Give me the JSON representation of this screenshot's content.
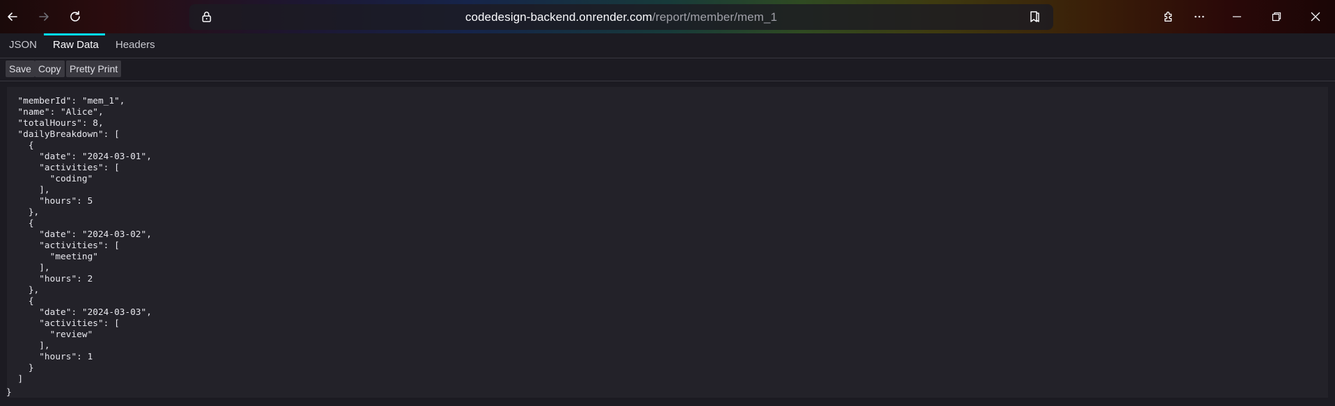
{
  "browser": {
    "url_host": "codedesign-backend.onrender.com",
    "url_path": "/report/member/mem_1"
  },
  "viewer": {
    "tabs": [
      {
        "label": "JSON",
        "active": false
      },
      {
        "label": "Raw Data",
        "active": true
      },
      {
        "label": "Headers",
        "active": false
      }
    ],
    "buttons": {
      "save": "Save",
      "copy": "Copy",
      "pretty_print": "Pretty Print"
    }
  },
  "raw_data": {
    "open_brace": "{",
    "close_brace": "}",
    "body": "  \"memberId\": \"mem_1\",\n  \"name\": \"Alice\",\n  \"totalHours\": 8,\n  \"dailyBreakdown\": [\n    {\n      \"date\": \"2024-03-01\",\n      \"activities\": [\n        \"coding\"\n      ],\n      \"hours\": 5\n    },\n    {\n      \"date\": \"2024-03-02\",\n      \"activities\": [\n        \"meeting\"\n      ],\n      \"hours\": 2\n    },\n    {\n      \"date\": \"2024-03-03\",\n      \"activities\": [\n        \"review\"\n      ],\n      \"hours\": 1\n    }\n  ]"
  },
  "icons": {
    "back": "back-arrow-icon",
    "forward": "forward-arrow-icon",
    "reload": "reload-icon",
    "lock": "lock-icon",
    "reader": "reader-view-icon",
    "extensions": "puzzle-icon",
    "menu": "more-horizontal-icon",
    "minimize": "minimize-icon",
    "restore": "restore-icon",
    "close": "close-icon"
  },
  "colors": {
    "page_background": "#1c1b22",
    "panel_background": "#232229",
    "active_tab_indicator": "#00ddff",
    "button_background": "#3a3940"
  }
}
